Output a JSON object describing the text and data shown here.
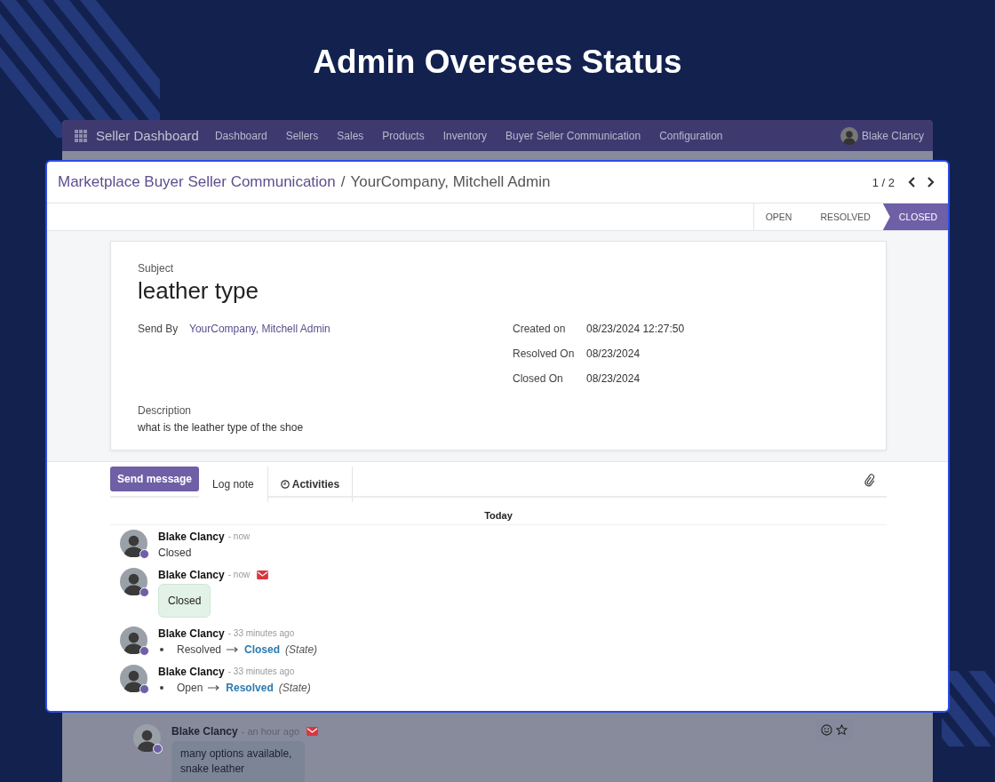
{
  "headline": "Admin Oversees Status",
  "background_app": {
    "navbar": {
      "app_name": "Seller Dashboard",
      "menu": [
        "Dashboard",
        "Sellers",
        "Sales",
        "Products",
        "Inventory",
        "Buyer Seller Communication",
        "Configuration"
      ],
      "user": "Blake Clancy"
    },
    "messages": [
      {
        "author": "Blake Clancy",
        "time": "- an hour ago",
        "kind": "email",
        "body": "many options available, snake leather"
      }
    ]
  },
  "record": {
    "breadcrumb": {
      "parent": "Marketplace Buyer Seller Communication",
      "separator": "/",
      "current": "YourCompany, Mitchell Admin"
    },
    "pager": "1 / 2",
    "stages": [
      {
        "label": "OPEN",
        "selected": false
      },
      {
        "label": "RESOLVED",
        "selected": false
      },
      {
        "label": "CLOSED",
        "selected": true
      }
    ],
    "subject_label": "Subject",
    "subject": "leather type",
    "fields_left": [
      {
        "label": "Send By",
        "value": "YourCompany, Mitchell Admin",
        "kind": "link"
      }
    ],
    "fields_right": [
      {
        "label": "Created on",
        "value": "08/23/2024 12:27:50"
      },
      {
        "label": "Resolved On",
        "value": "08/23/2024"
      },
      {
        "label": "Closed On",
        "value": "08/23/2024"
      }
    ],
    "description_label": "Description",
    "description": "what is the leather type of the shoe"
  },
  "chatter": {
    "actions": [
      {
        "label": "Send message",
        "kind": "primary"
      },
      {
        "label": "Log note",
        "kind": "tab"
      },
      {
        "label": "Activities",
        "kind": "activity"
      }
    ],
    "date_separator": "Today",
    "messages": [
      {
        "author": "Blake Clancy",
        "time": "- now",
        "kind": "note",
        "body": "Closed"
      },
      {
        "author": "Blake Clancy",
        "time": "- now",
        "kind": "email",
        "body": "Closed"
      },
      {
        "author": "Blake Clancy",
        "time": "- 33 minutes ago",
        "kind": "tracking",
        "old": "Resolved",
        "new": "Closed",
        "field": "(State)"
      },
      {
        "author": "Blake Clancy",
        "time": "- 33 minutes ago",
        "kind": "tracking",
        "old": "Open",
        "new": "Resolved",
        "field": "(State)"
      }
    ]
  }
}
